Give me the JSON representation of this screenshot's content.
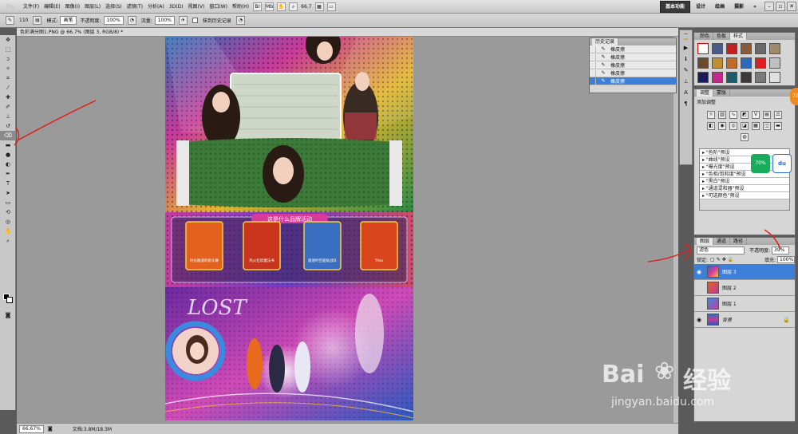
{
  "app": {
    "logo": "Ps"
  },
  "menu": {
    "items": [
      "文件(F)",
      "编辑(E)",
      "图像(I)",
      "图层(L)",
      "选择(S)",
      "滤镜(T)",
      "分析(A)",
      "3D(D)",
      "视图(V)",
      "窗口(W)",
      "帮助(H)"
    ]
  },
  "menubar": {
    "zoom": "66.7",
    "workspaces": [
      "基本功能",
      "设计",
      "绘画",
      "摄影"
    ],
    "more": "»"
  },
  "options": {
    "brush_size": "110",
    "mode_label": "模式:",
    "mode_value": "画笔",
    "opacity_label": "不透明度:",
    "opacity_value": "100%",
    "flow_label": "流量:",
    "flow_value": "100%",
    "history_label": "抹到历史记录"
  },
  "document": {
    "tab": "色彩满分图1.PNG @ 66.7% (图层 3, RGB/8) *"
  },
  "status": {
    "zoom": "66.67%",
    "doc": "文档:3.8M/18.3M"
  },
  "history": {
    "title": "历史记录",
    "items": [
      "橡皮擦",
      "橡皮擦",
      "橡皮擦",
      "橡皮擦",
      "橡皮擦"
    ]
  },
  "styles_panel": {
    "tabs": [
      "颜色",
      "色板",
      "样式"
    ]
  },
  "adjust_panel": {
    "tabs": [
      "调整",
      "蒙版"
    ],
    "header": "添加调整",
    "presets": [
      "\"色阶\"预设",
      "\"曲线\"预设",
      "\"曝光度\"预设",
      "\"色相/饱和度\"预设",
      "\"黑白\"预设",
      "\"通道混和器\"预设",
      "\"可选颜色\"预设"
    ]
  },
  "layers_panel": {
    "tabs": [
      "图层",
      "通道",
      "路径"
    ],
    "blend_mode": "滤色",
    "opacity_label": "不透明度:",
    "opacity_value": "39%",
    "lock_label": "锁定:",
    "fill_label": "填充:",
    "fill_value": "100%",
    "layers": [
      "图层 3",
      "图层 2",
      "图层 1",
      "背景"
    ]
  },
  "artwork": {
    "title_text": "这是什么品牌活动",
    "poster_captions": [
      "时光隧道的街头舞",
      "热火狂欢魔法书",
      "极速时空超级战队",
      "Thks"
    ],
    "lost_text": "LOST"
  },
  "badges": {
    "percent": "70%",
    "baidu_small": "du",
    "orange": "70"
  },
  "watermark": {
    "brand": "Bai",
    "brand_cn": "经验",
    "url": "jingyan.baidu.com"
  }
}
